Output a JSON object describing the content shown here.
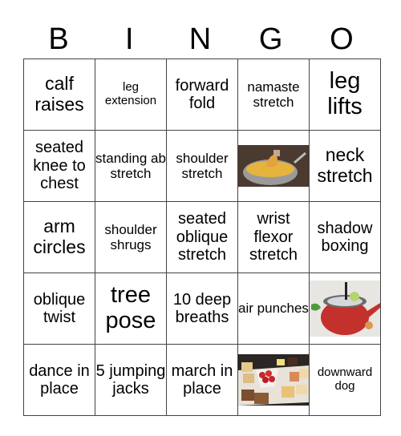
{
  "header": {
    "letters": [
      "B",
      "I",
      "N",
      "G",
      "O"
    ]
  },
  "board": {
    "rows": [
      [
        {
          "type": "text",
          "text": "calf raises"
        },
        {
          "type": "text",
          "text": "leg extension"
        },
        {
          "type": "text",
          "text": "forward fold"
        },
        {
          "type": "text",
          "text": "namaste stretch"
        },
        {
          "type": "text",
          "text": "leg lifts"
        }
      ],
      [
        {
          "type": "text",
          "text": "seated knee to chest"
        },
        {
          "type": "text",
          "text": "standing ab stretch"
        },
        {
          "type": "text",
          "text": "shoulder stretch"
        },
        {
          "type": "image",
          "image": "cheese-fondue-pot"
        },
        {
          "type": "text",
          "text": "neck stretch"
        }
      ],
      [
        {
          "type": "text",
          "text": "arm circles"
        },
        {
          "type": "text",
          "text": "shoulder shrugs"
        },
        {
          "type": "text",
          "text": "seated oblique stretch"
        },
        {
          "type": "text",
          "text": "wrist flexor stretch"
        },
        {
          "type": "text",
          "text": "shadow boxing"
        }
      ],
      [
        {
          "type": "text",
          "text": "oblique twist"
        },
        {
          "type": "text",
          "text": "tree pose"
        },
        {
          "type": "text",
          "text": "10 deep breaths"
        },
        {
          "type": "text",
          "text": "air punches"
        },
        {
          "type": "image",
          "image": "red-mug-drink"
        }
      ],
      [
        {
          "type": "text",
          "text": "dance in place"
        },
        {
          "type": "text",
          "text": "5 jumping jacks"
        },
        {
          "type": "text",
          "text": "march in place"
        },
        {
          "type": "image",
          "image": "dessert-platter"
        },
        {
          "type": "text",
          "text": "downward dog"
        }
      ]
    ]
  }
}
